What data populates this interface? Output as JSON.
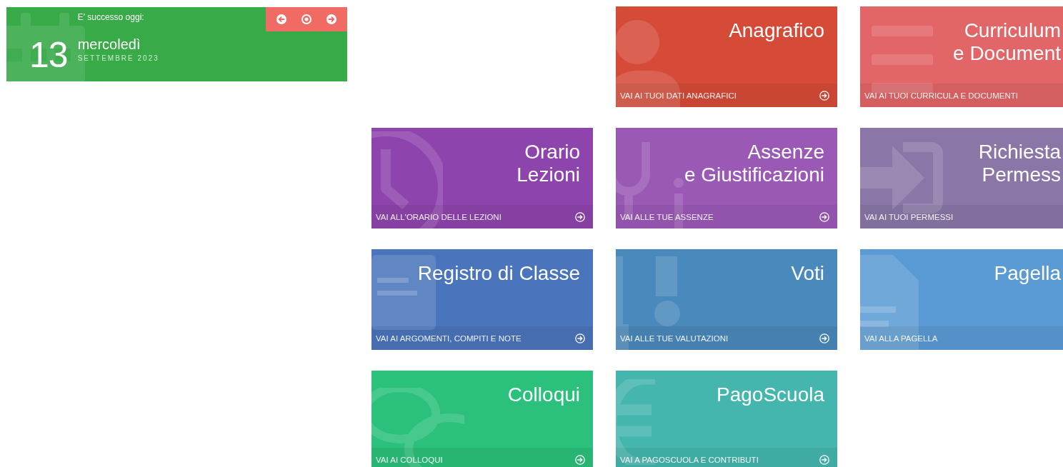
{
  "today_widget": {
    "heading": "E' successo oggi:",
    "day": "13",
    "weekday": "mercoledì",
    "month_year": "SETTEMBRE 2023"
  },
  "tile_rows": [
    [
      {
        "title": "Anagrafico",
        "link": "VAI AI TUOI DATI ANAGRAFICI",
        "color": "#d64a38"
      },
      {
        "title": "Curriculum\ne Document",
        "link": "VAI AI TUOI CURRICULA E DOCUMENTI",
        "color": "#e26567"
      }
    ],
    [
      {
        "title": "Orario\nLezioni",
        "link": "VAI ALL'ORARIO DELLE LEZIONI",
        "color": "#8e44ad"
      },
      {
        "title": "Assenze\ne Giustificazioni",
        "link": "VAI ALLE TUE ASSENZE",
        "color": "#9b59b6"
      },
      {
        "title": "Richiesta\nPermess",
        "link": "VAI AI TUOI PERMESSI",
        "color": "#8a77a8"
      }
    ],
    [
      {
        "title": "Registro di Classe",
        "link": "VAI AI ARGOMENTI, COMPITI E NOTE",
        "color": "#4a74bc"
      },
      {
        "title": "Voti",
        "link": "VAI ALLE TUE VALUTAZIONI",
        "color": "#4a89bb"
      },
      {
        "title": "Pagella",
        "link": "VAI ALLA PAGELLA",
        "color": "#5b9bd5"
      }
    ],
    [
      {
        "title": "Colloqui",
        "link": "VAI AI COLLOQUI",
        "color": "#2bc17c"
      },
      {
        "title": "PagoScuola",
        "link": "VAI A PAGOSCUOLA E CONTRIBUTI",
        "color": "#45b6ae"
      }
    ]
  ]
}
